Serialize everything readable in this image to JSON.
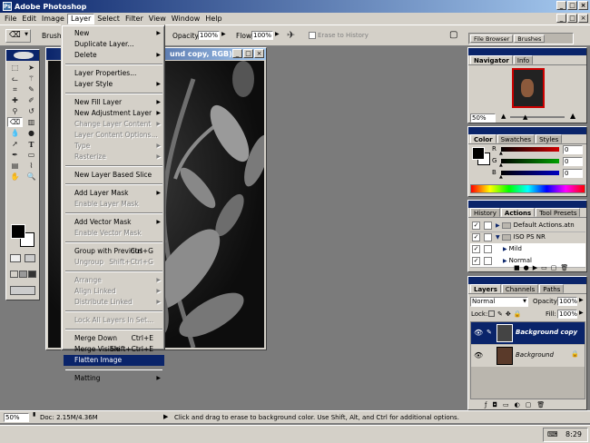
{
  "app": {
    "title": "Adobe Photoshop"
  },
  "menubar": [
    "File",
    "Edit",
    "Image",
    "Layer",
    "Select",
    "Filter",
    "View",
    "Window",
    "Help"
  ],
  "options": {
    "brush_label": "Brush:",
    "opacity_label": "Opacity:",
    "opacity_value": "100%",
    "flow_label": "Flow:",
    "flow_value": "100%",
    "erase_history": "Erase to History"
  },
  "panel_well": {
    "file_browser": "File Browser",
    "brushes": "Brushes"
  },
  "document": {
    "title": "und copy, RGB)"
  },
  "layer_menu": [
    {
      "label": "New",
      "arrow": true,
      "state": "enabled"
    },
    {
      "label": "Duplicate Layer...",
      "state": "enabled"
    },
    {
      "label": "Delete",
      "arrow": true,
      "state": "enabled"
    },
    {
      "sep": true
    },
    {
      "label": "Layer Properties...",
      "state": "enabled"
    },
    {
      "label": "Layer Style",
      "arrow": true,
      "state": "enabled"
    },
    {
      "sep": true
    },
    {
      "label": "New Fill Layer",
      "arrow": true,
      "state": "enabled"
    },
    {
      "label": "New Adjustment Layer",
      "arrow": true,
      "state": "enabled"
    },
    {
      "label": "Change Layer Content",
      "arrow": true,
      "state": "disabled"
    },
    {
      "label": "Layer Content Options...",
      "state": "disabled"
    },
    {
      "label": "Type",
      "arrow": true,
      "state": "disabled"
    },
    {
      "label": "Rasterize",
      "arrow": true,
      "state": "disabled"
    },
    {
      "sep": true
    },
    {
      "label": "New Layer Based Slice",
      "state": "enabled"
    },
    {
      "sep": true
    },
    {
      "label": "Add Layer Mask",
      "arrow": true,
      "state": "enabled"
    },
    {
      "label": "Enable Layer Mask",
      "state": "disabled"
    },
    {
      "sep": true
    },
    {
      "label": "Add Vector Mask",
      "arrow": true,
      "state": "enabled"
    },
    {
      "label": "Enable Vector Mask",
      "state": "disabled"
    },
    {
      "sep": true
    },
    {
      "label": "Group with Previous",
      "shortcut": "Ctrl+G",
      "state": "enabled"
    },
    {
      "label": "Ungroup",
      "shortcut": "Shift+Ctrl+G",
      "state": "disabled"
    },
    {
      "sep": true
    },
    {
      "label": "Arrange",
      "arrow": true,
      "state": "disabled"
    },
    {
      "label": "Align Linked",
      "arrow": true,
      "state": "disabled"
    },
    {
      "label": "Distribute Linked",
      "arrow": true,
      "state": "disabled"
    },
    {
      "sep": true
    },
    {
      "label": "Lock All Layers In Set...",
      "state": "disabled"
    },
    {
      "sep": true
    },
    {
      "label": "Merge Down",
      "shortcut": "Ctrl+E",
      "state": "enabled"
    },
    {
      "label": "Merge Visible",
      "shortcut": "Shift+Ctrl+E",
      "state": "enabled"
    },
    {
      "label": "Flatten Image",
      "state": "selected"
    },
    {
      "sep": true
    },
    {
      "label": "Matting",
      "arrow": true,
      "state": "enabled"
    }
  ],
  "navigator": {
    "tabs": [
      "Navigator",
      "Info"
    ],
    "zoom": "50%"
  },
  "color": {
    "tabs": [
      "Color",
      "Swatches",
      "Styles"
    ],
    "channels": [
      {
        "label": "R",
        "value": "0",
        "color": "#d00000"
      },
      {
        "label": "G",
        "value": "0",
        "color": "#00a000"
      },
      {
        "label": "B",
        "value": "0",
        "color": "#0000c0"
      }
    ]
  },
  "actions": {
    "tabs": [
      "History",
      "Actions",
      "Tool Presets"
    ],
    "items": [
      {
        "label": "Default Actions.atn",
        "kind": "set"
      },
      {
        "label": "ISO PS NR",
        "kind": "set-open"
      },
      {
        "label": "Mild",
        "kind": "action"
      },
      {
        "label": "Normal",
        "kind": "action"
      }
    ]
  },
  "layers": {
    "tabs": [
      "Layers",
      "Channels",
      "Paths"
    ],
    "blend_mode": "Normal",
    "opacity_label": "Opacity:",
    "opacity": "100%",
    "lock_label": "Lock:",
    "fill_label": "Fill:",
    "fill": "100%",
    "items": [
      {
        "name": "Background copy",
        "selected": true
      },
      {
        "name": "Background",
        "selected": false
      }
    ]
  },
  "status": {
    "zoom": "50%",
    "doc": "Doc: 2.15M/4.36M",
    "hint": "Click and drag to erase to background color.  Use Shift, Alt, and Ctrl for additional options."
  },
  "taskbar": {
    "time": "8:29"
  },
  "icons": [
    "eraser-icon",
    "marquee-icon",
    "move-icon",
    "lasso-icon",
    "wand-icon",
    "crop-icon",
    "slice-icon",
    "heal-icon",
    "brush-icon",
    "stamp-icon",
    "history-brush-icon",
    "eraser-tool-icon",
    "gradient-icon",
    "dodge-icon",
    "path-select-icon",
    "type-icon",
    "pen-icon",
    "shape-icon",
    "notes-icon",
    "eyedropper-icon",
    "hand-icon",
    "zoom-icon"
  ]
}
